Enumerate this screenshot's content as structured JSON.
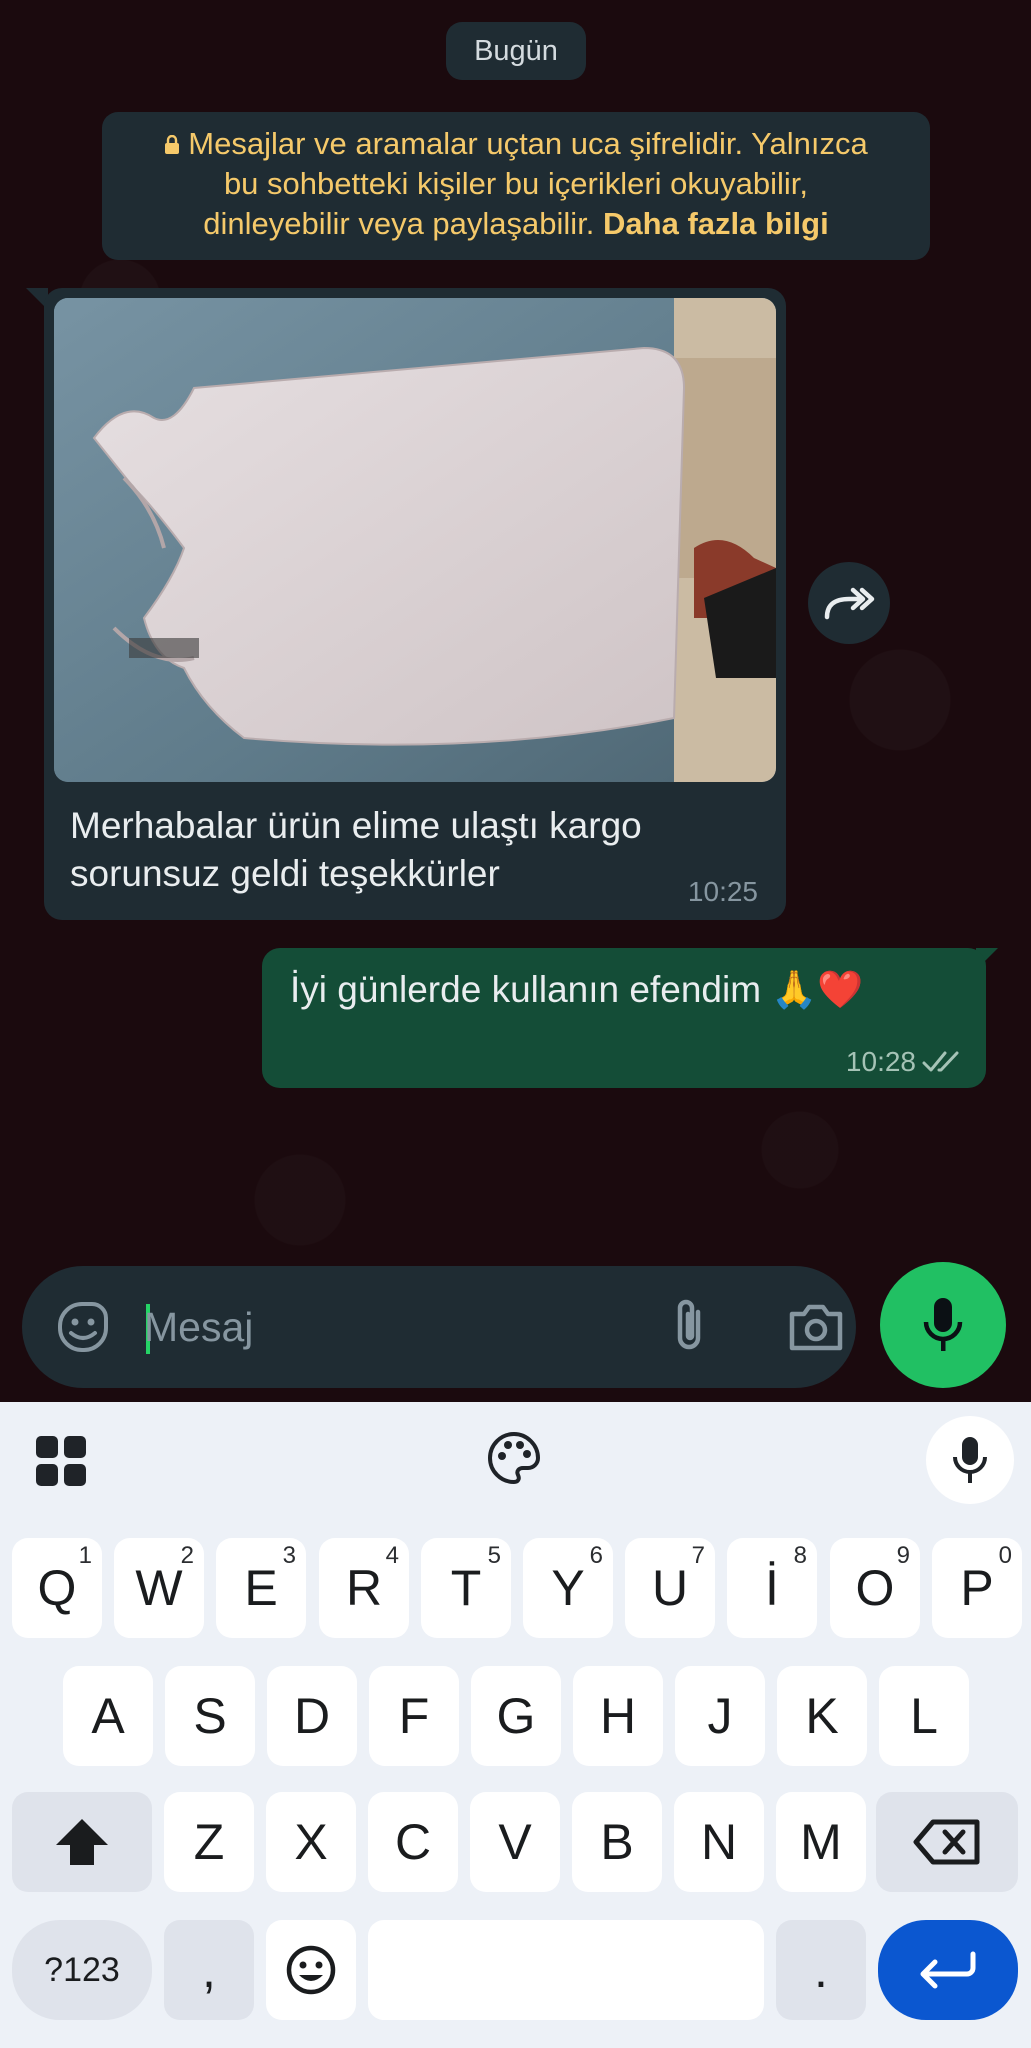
{
  "chat": {
    "date_chip": "Bugün",
    "encryption_notice": {
      "line1": "Mesajlar ve aramalar uçtan uca şifrelidir. Yalnızca",
      "line2": "bu sohbetteki kişiler bu içerikleri okuyabilir,",
      "line3": "dinleyebilir veya paylaşabilir.",
      "link": "Daha fazla bilgi"
    },
    "incoming_message": {
      "caption_line1": "Merhabalar ürün elime ulaştı kargo",
      "caption_line2": "sorunsuz geldi teşekkürler",
      "time": "10:25",
      "has_photo": true
    },
    "outgoing_message": {
      "text": "İyi günlerde kullanın efendim 🙏❤️",
      "time": "10:28",
      "status": "read"
    }
  },
  "composer": {
    "placeholder": "Mesaj"
  },
  "keyboard": {
    "row1": [
      {
        "label": "Q",
        "hint": "1"
      },
      {
        "label": "W",
        "hint": "2"
      },
      {
        "label": "E",
        "hint": "3"
      },
      {
        "label": "R",
        "hint": "4"
      },
      {
        "label": "T",
        "hint": "5"
      },
      {
        "label": "Y",
        "hint": "6"
      },
      {
        "label": "U",
        "hint": "7"
      },
      {
        "label": "İ",
        "hint": "8"
      },
      {
        "label": "O",
        "hint": "9"
      },
      {
        "label": "P",
        "hint": "0"
      }
    ],
    "row2": [
      "A",
      "S",
      "D",
      "F",
      "G",
      "H",
      "J",
      "K",
      "L"
    ],
    "row3": [
      "Z",
      "X",
      "C",
      "V",
      "B",
      "N",
      "M"
    ],
    "symbols_label": "?123",
    "comma_label": ",",
    "period_label": "."
  },
  "colors": {
    "chat_background": "#1b0a0e",
    "incoming_bubble": "#1f2c33",
    "outgoing_bubble": "#144d37",
    "accent_green": "#21c063",
    "notice_text": "#f5c96a",
    "enter_key": "#0b57d0"
  }
}
